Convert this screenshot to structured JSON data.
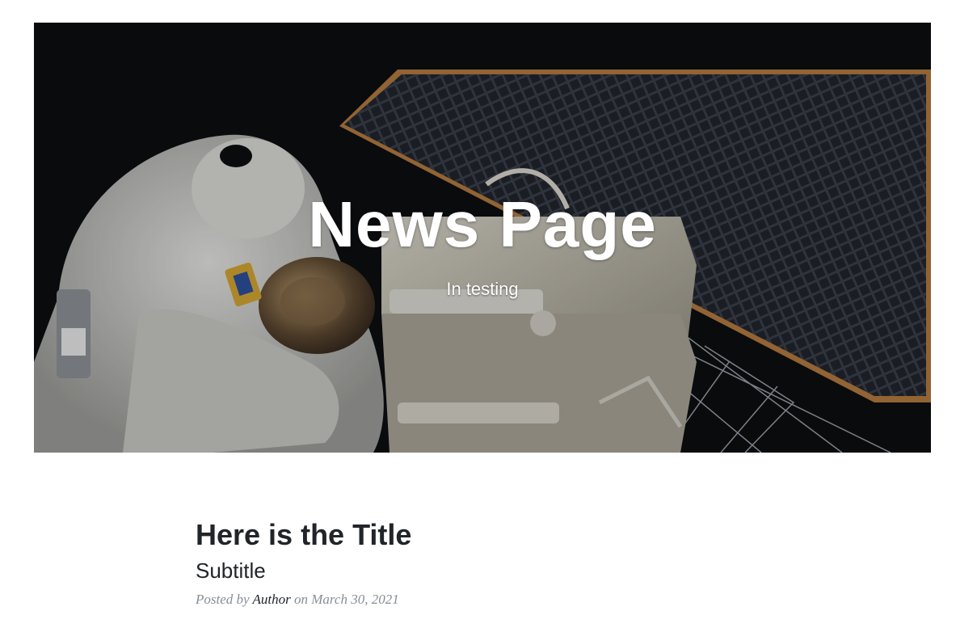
{
  "masthead": {
    "title": "News Page",
    "subtitle": "In testing",
    "background_image": "astronaut-spacewalk-solar-panel"
  },
  "posts": [
    {
      "title": "Here is the Title",
      "subtitle": "Subtitle",
      "meta_prefix": "Posted by",
      "author": "Author",
      "meta_on": "on",
      "date": "March 30, 2021"
    }
  ],
  "colors": {
    "heading_text": "#212529",
    "meta_text": "#868e96",
    "hero_text": "#ffffff"
  }
}
